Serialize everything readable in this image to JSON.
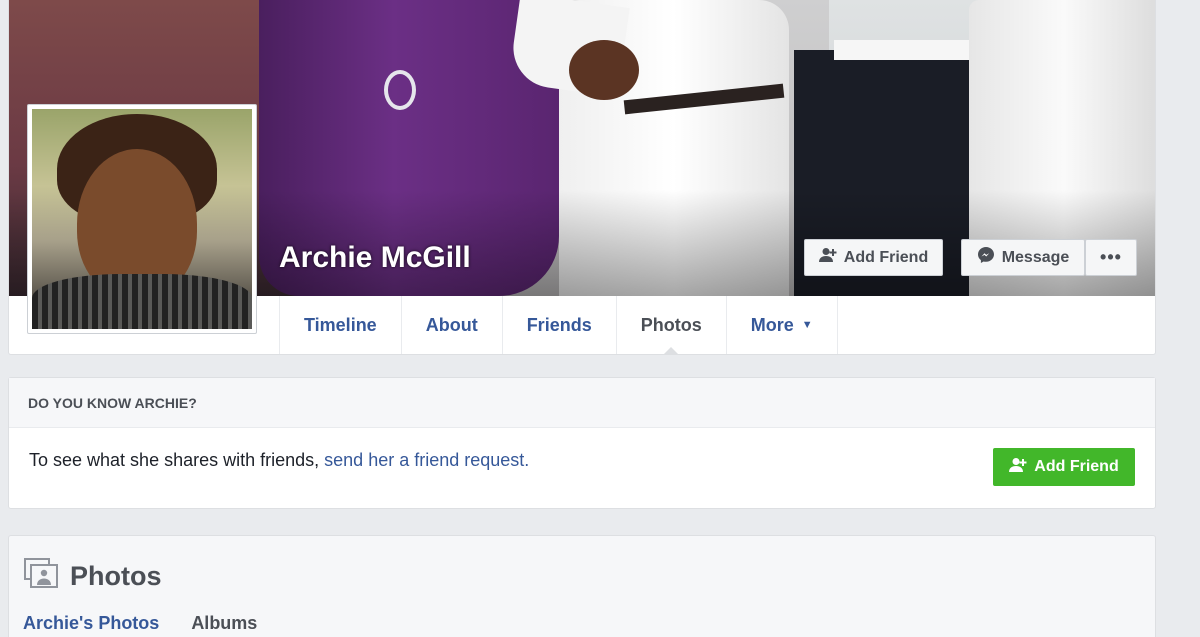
{
  "profile": {
    "name": "Archie McGill"
  },
  "header_actions": {
    "add_friend_label": "Add Friend",
    "message_label": "Message",
    "more_label": "•••"
  },
  "nav": {
    "tabs": [
      {
        "label": "Timeline",
        "active": false
      },
      {
        "label": "About",
        "active": false
      },
      {
        "label": "Friends",
        "active": false
      },
      {
        "label": "Photos",
        "active": true
      },
      {
        "label": "More",
        "active": false
      }
    ]
  },
  "know_card": {
    "title": "DO YOU KNOW ARCHIE?",
    "text": "To see what she shares with friends, ",
    "link": "send her a friend request.",
    "button_label": "Add Friend"
  },
  "photos_section": {
    "title": "Photos",
    "tabs": [
      "Archie's Photos",
      "Albums"
    ]
  },
  "colors": {
    "link_blue": "#365899",
    "green_button": "#42b72a",
    "page_bg": "#e9ebee"
  }
}
